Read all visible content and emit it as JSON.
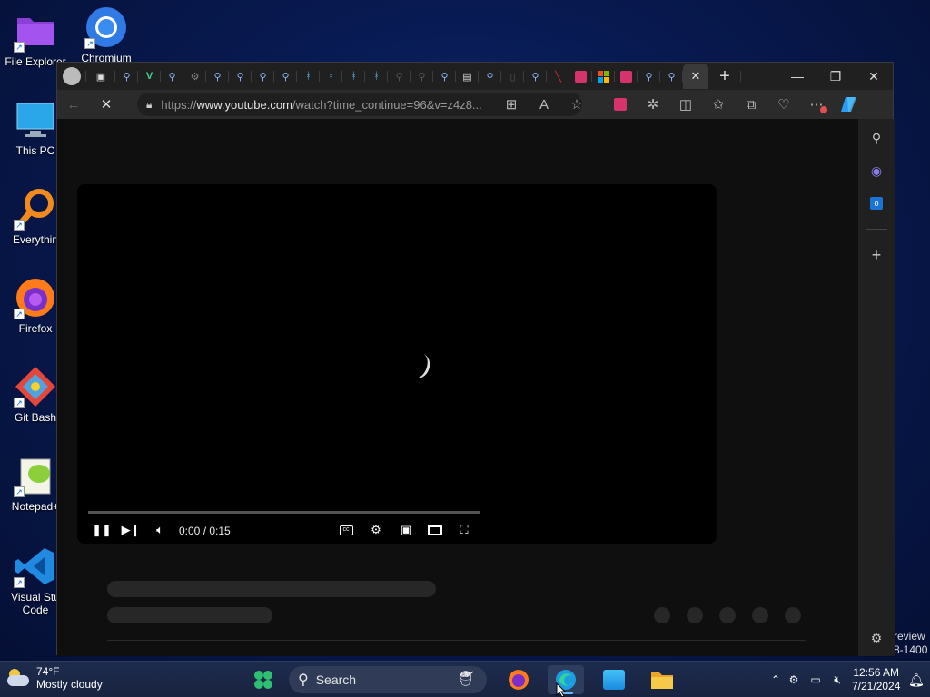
{
  "desktop": {
    "icons": [
      {
        "label": "File Explorer"
      },
      {
        "label": "Chromium"
      },
      {
        "label": "This PC"
      },
      {
        "label": "Everythin"
      },
      {
        "label": "Firefox"
      },
      {
        "label": "Git Bash"
      },
      {
        "label": "Notepad+"
      },
      {
        "label": "Visual Stu",
        "label2": "Code"
      }
    ],
    "watermark": {
      "line1": "review",
      "line2": "8-1400"
    }
  },
  "browser": {
    "url_prefix": "https://",
    "url_host": "www.youtube.com",
    "url_path": "/watch?time_continue=96&v=z4z8...",
    "close_tab_symbol": "✕",
    "new_tab_symbol": "+"
  },
  "player": {
    "timecode": "0:00 / 0:15"
  },
  "taskbar": {
    "weather_temp": "74°F",
    "weather_desc": "Mostly cloudy",
    "search_label": "Search",
    "time": "12:56 AM",
    "date": "7/21/2024"
  },
  "colors": {
    "accent": "#3a8ee6",
    "wallpaper": "#0b1f5e"
  }
}
